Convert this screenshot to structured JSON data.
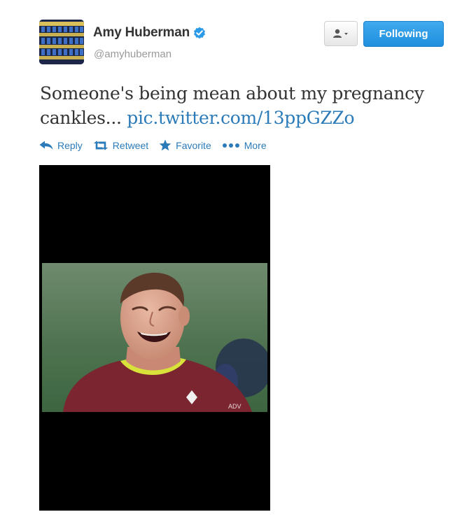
{
  "user": {
    "display_name": "Amy Huberman",
    "handle": "@amyhuberman",
    "verified": true,
    "avatar_icon": "avatar-image"
  },
  "controls": {
    "user_menu_icon": "person-dropdown-icon",
    "follow_label": "Following"
  },
  "tweet": {
    "text": "Someone's being mean about my pregnancy cankles... ",
    "link_text": "pic.twitter.com/13ppGZZo"
  },
  "actions": [
    {
      "label": "Reply",
      "icon": "reply-icon"
    },
    {
      "label": "Retweet",
      "icon": "retweet-icon"
    },
    {
      "label": "Favorite",
      "icon": "star-icon"
    },
    {
      "label": "More",
      "icon": "more-dots-icon"
    }
  ],
  "media": {
    "type": "photo",
    "subject": "man-laughing"
  },
  "colors": {
    "link": "#2b7bb9",
    "follow_button": "#2b94e1",
    "text": "#333333",
    "handle": "#999999",
    "verified": "#2b9ae8"
  }
}
